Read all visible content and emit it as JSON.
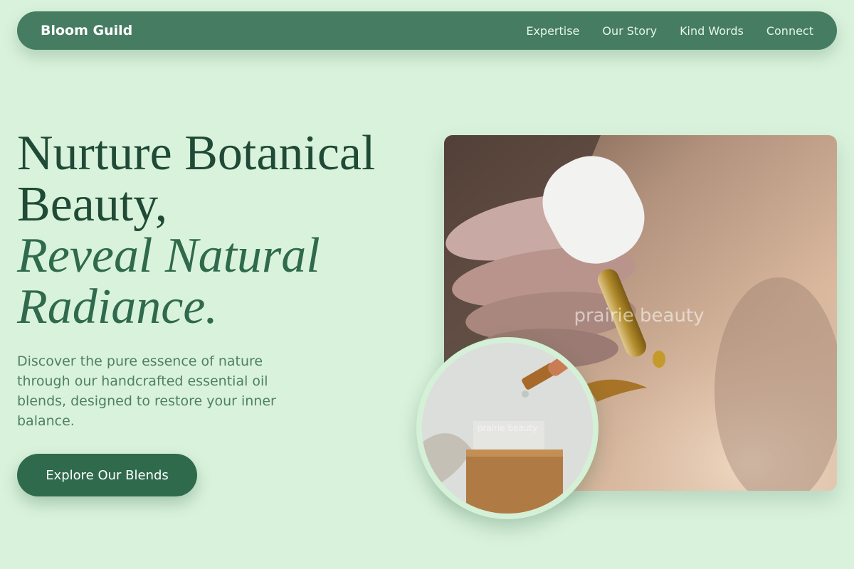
{
  "nav": {
    "brand": "Bloom Guild",
    "links": [
      "Expertise",
      "Our Story",
      "Kind Words",
      "Connect"
    ]
  },
  "hero": {
    "title_line1": "Nurture Botanical",
    "title_line2": "Beauty,",
    "title_line3": "Reveal Natural",
    "title_line4": "Radiance.",
    "description": "Discover the pure essence of nature through our handcrafted essential oil blends, designed to restore your inner balance.",
    "cta_label": "Explore Our Blends"
  },
  "images": {
    "main_watermark": "prairie beauty",
    "circle_watermark": "prairie beauty"
  },
  "colors": {
    "background": "#d9f2dc",
    "nav": "#457c62",
    "primary": "#2f6a4c",
    "heading": "#1f4a36"
  }
}
